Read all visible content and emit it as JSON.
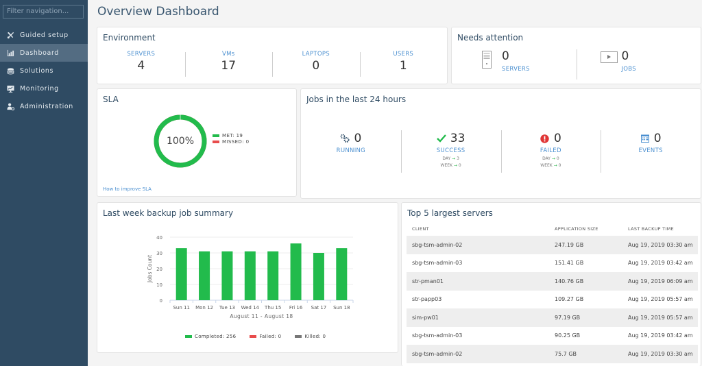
{
  "sidebar": {
    "filter_placeholder": "Filter navigation...",
    "items": [
      {
        "label": "Guided setup",
        "icon": "tools-icon",
        "active": false
      },
      {
        "label": "Dashboard",
        "icon": "dashboard-icon",
        "active": true
      },
      {
        "label": "Solutions",
        "icon": "layers-icon",
        "active": false
      },
      {
        "label": "Monitoring",
        "icon": "monitor-icon",
        "active": false
      },
      {
        "label": "Administration",
        "icon": "user-gear-icon",
        "active": false
      }
    ]
  },
  "page": {
    "title": "Overview Dashboard"
  },
  "environment": {
    "title": "Environment",
    "stats": [
      {
        "label": "SERVERS",
        "value": "4"
      },
      {
        "label": "VMs",
        "value": "17"
      },
      {
        "label": "LAPTOPS",
        "value": "0"
      },
      {
        "label": "USERS",
        "value": "1"
      }
    ]
  },
  "attention": {
    "title": "Needs attention",
    "servers": {
      "label": "SERVERS",
      "value": "0",
      "icon": "server-icon"
    },
    "jobs": {
      "label": "JOBS",
      "value": "0",
      "icon": "play-icon"
    }
  },
  "sla": {
    "title": "SLA",
    "percent_label": "100%",
    "met_fraction": 1.0,
    "met_label": "MET:",
    "met_value": "19",
    "missed_label": "MISSED:",
    "missed_value": "0",
    "link": "How to improve SLA",
    "colors": {
      "met": "#22bb4c",
      "missed": "#e84c4c"
    }
  },
  "jobs": {
    "title": "Jobs in the last 24 hours",
    "running": {
      "label": "RUNNING",
      "value": "0"
    },
    "success": {
      "label": "SUCCESS",
      "value": "33",
      "day_label": "DAY",
      "day_value": "3",
      "week_label": "WEEK",
      "week_value": "0"
    },
    "failed": {
      "label": "FAILED",
      "value": "0",
      "day_label": "DAY",
      "day_value": "0",
      "week_label": "WEEK",
      "week_value": "0"
    },
    "events": {
      "label": "EVENTS",
      "value": "0"
    },
    "arrow": "→"
  },
  "backup": {
    "title": "Last week backup job summary"
  },
  "chart_data": {
    "type": "bar",
    "title": "Last week backup job summary",
    "categories": [
      "Sun 11",
      "Mon 12",
      "Tue 13",
      "Wed 14",
      "Thu 15",
      "Fri 16",
      "Sat 17",
      "Sun 18"
    ],
    "series": [
      {
        "name": "Completed",
        "values": [
          33,
          31,
          31,
          31,
          31,
          36,
          30,
          33
        ],
        "color": "#22bb4c"
      },
      {
        "name": "Failed",
        "values": [
          0,
          0,
          0,
          0,
          0,
          0,
          0,
          0
        ],
        "color": "#e84c4c"
      },
      {
        "name": "Killed",
        "values": [
          0,
          0,
          0,
          0,
          0,
          0,
          0,
          0
        ],
        "color": "#777777"
      }
    ],
    "xlabel": "August 11 - August 18",
    "ylabel": "Jobs Count",
    "ylim": [
      0,
      40
    ],
    "yticks": [
      0,
      10,
      20,
      30,
      40
    ],
    "grid": true,
    "legend": [
      {
        "label": "Completed: 256",
        "color": "#22bb4c"
      },
      {
        "label": "Failed: 0",
        "color": "#e84c4c"
      },
      {
        "label": "Killed: 0",
        "color": "#777777"
      }
    ],
    "legend_position": "bottom"
  },
  "servers": {
    "title": "Top 5 largest servers",
    "columns": [
      "CLIENT",
      "APPLICATION SIZE",
      "LAST BACKUP TIME"
    ],
    "rows": [
      [
        "sbg-tsm-admin-02",
        "247.19 GB",
        "Aug 19, 2019 03:30 am"
      ],
      [
        "sbg-tsm-admin-03",
        "151.41 GB",
        "Aug 19, 2019 03:42 am"
      ],
      [
        "str-pman01",
        "140.76 GB",
        "Aug 19, 2019 06:09 am"
      ],
      [
        "str-papp03",
        "109.27 GB",
        "Aug 19, 2019 05:57 am"
      ],
      [
        "sim-pw01",
        "97.19 GB",
        "Aug 19, 2019 05:57 am"
      ],
      [
        "sbg-tsm-admin-03",
        "90.25 GB",
        "Aug 19, 2019 03:42 am"
      ],
      [
        "sbg-tsm-admin-02",
        "75.7 GB",
        "Aug 19, 2019 03:30 am"
      ]
    ]
  }
}
